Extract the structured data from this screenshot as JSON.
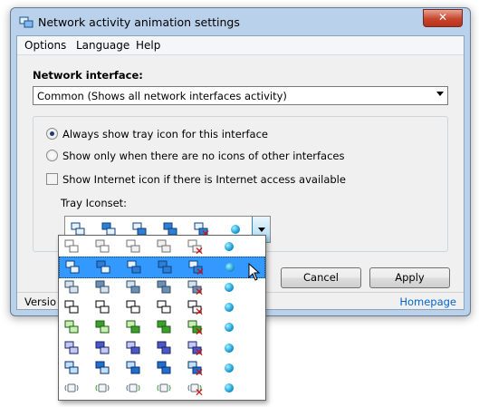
{
  "window": {
    "title": "Network activity animation settings",
    "close_label": "✕"
  },
  "menu": {
    "items": [
      "Options",
      "Language",
      "Help"
    ]
  },
  "network_interface": {
    "label": "Network interface:",
    "selected": "Common (Shows all network interfaces activity)"
  },
  "options": {
    "radio_always": "Always show tray icon for this interface",
    "radio_only_when": "Show only when there are no icons of other interfaces",
    "checkbox_internet": "Show Internet icon if there is Internet access available",
    "tray_iconset_label": "Tray Iconset:"
  },
  "buttons": {
    "cancel": "Cancel",
    "apply": "Apply"
  },
  "statusbar": {
    "version_text": "Versio",
    "homepage_link": "Homepage"
  },
  "iconsets": [
    {
      "style": "white-double",
      "selected": false
    },
    {
      "style": "blue-double",
      "selected": true
    },
    {
      "style": "gray-blue",
      "selected": false
    },
    {
      "style": "black-outline",
      "selected": false
    },
    {
      "style": "green",
      "selected": false
    },
    {
      "style": "xp-network",
      "selected": false
    },
    {
      "style": "classic-blue",
      "selected": false
    },
    {
      "style": "wireless",
      "selected": false
    }
  ],
  "colors": {
    "window_frame": "#b9d1ea",
    "selection": "#3399ff",
    "link": "#0066cc",
    "error_x": "#d01010"
  }
}
